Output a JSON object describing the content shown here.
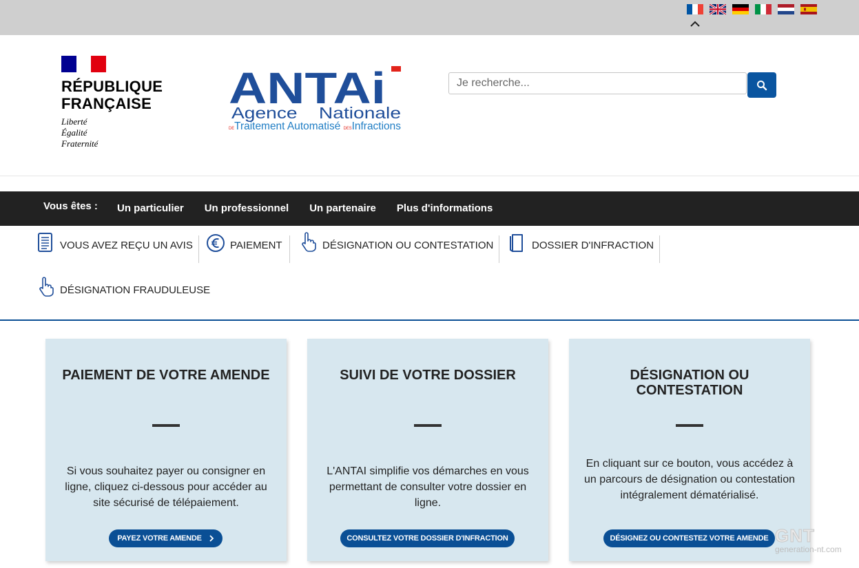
{
  "topbar": {
    "languages": [
      {
        "name": "flag-fr-icon",
        "colors": [
          "#0055a4",
          "#ffffff",
          "#ef4135"
        ]
      },
      {
        "name": "flag-uk-icon",
        "colors": [
          "#012169",
          "#ffffff",
          "#c8102e"
        ]
      },
      {
        "name": "flag-de-icon",
        "colors": [
          "#000000",
          "#dd0000",
          "#ffce00"
        ]
      },
      {
        "name": "flag-it-icon",
        "colors": [
          "#009246",
          "#ffffff",
          "#ce2b37"
        ]
      },
      {
        "name": "flag-nl-icon",
        "colors": [
          "#ae1c28",
          "#ffffff",
          "#21468b"
        ]
      },
      {
        "name": "flag-es-icon",
        "colors": [
          "#aa151b",
          "#f1bf00",
          "#aa151b"
        ]
      }
    ],
    "collapse_icon": "chevron-up-icon"
  },
  "header": {
    "rf_name_line1": "RÉPUBLIQUE",
    "rf_name_line2": "FRANÇAISE",
    "rf_motto_1": "Liberté",
    "rf_motto_2": "Égalité",
    "rf_motto_3": "Fraternité",
    "antai_brand": "ANTAi",
    "antai_line1": "Agence    Nationale",
    "antai_line2_prefix": "DE",
    "antai_line2_a": "Traitement Automatisé ",
    "antai_line2_mid": "DES",
    "antai_line2_b": "Infractions",
    "search_placeholder": "Je recherche..."
  },
  "navbar": {
    "intro": "Vous êtes :",
    "links": [
      "Un particulier",
      "Un professionnel",
      "Un partenaire",
      "Plus d'informations"
    ]
  },
  "subnav": {
    "items": [
      {
        "label": "VOUS AVEZ REÇU UN AVIS",
        "icon": "document-icon"
      },
      {
        "label": "PAIEMENT",
        "icon": "euro-icon"
      },
      {
        "label": "DÉSIGNATION OU CONTESTATION",
        "icon": "pointing-hand-icon"
      },
      {
        "label": "DOSSIER D'INFRACTION",
        "icon": "folder-icon"
      },
      {
        "label": "DÉSIGNATION FRAUDULEUSE",
        "icon": "pointing-hand-icon"
      }
    ]
  },
  "cards": [
    {
      "title": "PAIEMENT DE VOTRE AMENDE",
      "text": "Si vous souhaitez payer ou consigner en ligne, cliquez ci-dessous pour accéder au site sécurisé de télépaiement.",
      "button": "PAYEZ VOTRE AMENDE"
    },
    {
      "title": "SUIVI DE VOTRE DOSSIER",
      "text": "L'ANTAI simplifie vos démarches en vous permettant de consulter votre dossier en ligne.",
      "button": "CONSULTEZ VOTRE DOSSIER D'INFRACTION"
    },
    {
      "title": "DÉSIGNATION OU CONTESTATION",
      "text": "En cliquant sur ce bouton, vous accédez à un parcours de désignation ou contestation intégralement dématérialisé.",
      "button": "DÉSIGNEZ OU CONTESTEZ VOTRE AMENDE"
    }
  ],
  "watermark": {
    "big": "GNT",
    "small": "generation-nt.com"
  },
  "colors": {
    "accent_blue": "#0a4f95",
    "antai_red": "#e2231a",
    "navbar_bg": "#222222",
    "card_bg": "#d7e7ef"
  }
}
